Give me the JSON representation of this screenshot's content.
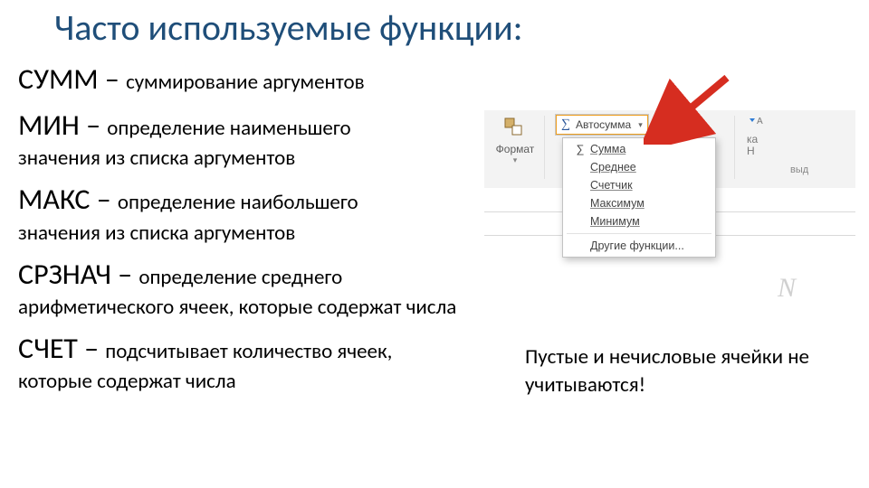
{
  "title": "Часто используемые функции:",
  "funcs": {
    "sum": {
      "name": "СУММ",
      "dash": "   – ",
      "desc1": "суммирование аргументов"
    },
    "min": {
      "name": "МИН",
      "dash": " – ",
      "desc1": "определение наименьшего",
      "cont": "значения из списка аргументов"
    },
    "max": {
      "name": "МАКС",
      "dash": " – ",
      "desc1": "определение наибольшего",
      "cont": "значения из списка аргументов"
    },
    "avg": {
      "name": "СРЗНАЧ",
      "dash": " – ",
      "desc1": "определение среднего",
      "cont": "арифметического ячеек, которые содержат числа"
    },
    "count": {
      "name": "СЧЕТ",
      "dash": " – ",
      "desc1": "подсчитывает количество ячеек,",
      "cont": "которые содержат числа"
    }
  },
  "note": "Пустые и нечисловые ячейки не учитываются!",
  "excel": {
    "format_label": "Формат",
    "autosum_label": "Автосумма",
    "menu": {
      "sum": "Сумма",
      "avg": "Среднее",
      "count": "Счетчик",
      "max": "Максимум",
      "min": "Минимум",
      "other": "Другие функции..."
    },
    "right": {
      "line1": "ка",
      "line2": "Н",
      "line3": "выд"
    }
  }
}
